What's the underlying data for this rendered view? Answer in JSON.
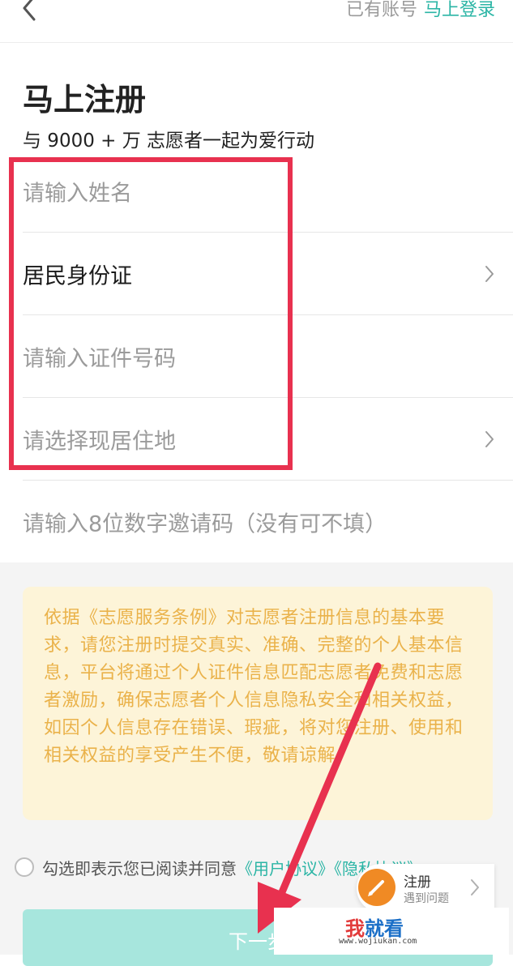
{
  "header": {
    "back_icon": "chevron-left-icon",
    "have_account": "已有账号",
    "login_link": "马上登录"
  },
  "page": {
    "title": "马上注册",
    "subtitle": "与 9000 + 万 志愿者一起为爱行动"
  },
  "form": {
    "name_placeholder": "请输入姓名",
    "id_type_value": "居民身份证",
    "id_number_placeholder": "请输入证件号码",
    "residence_placeholder": "请选择现居住地",
    "invite_placeholder": "请输入8位数字邀请码（没有可不填）"
  },
  "notice": {
    "text": "依据《志愿服务条例》对志愿者注册信息的基本要求，请您注册时提交真实、准确、完整的个人基本信息，平台将通过个人证件信息匹配志愿者免费和志愿者激励，确保志愿者个人信息隐私安全和相关权益，如因个人信息存在错误、瑕疵，将对您注册、使用和相关权益的享受产生不便，敬请谅解。"
  },
  "agreement": {
    "prefix": "勾选即表示您已阅读并同意",
    "user_agreement": "《用户协议》",
    "privacy": "《隐私协议》"
  },
  "help": {
    "title": "注册",
    "subtitle": "遇到问题"
  },
  "actions": {
    "next_label": "下一步"
  },
  "watermark": {
    "logo_red": "我",
    "logo_blue": "就看",
    "url": "www.wojiukan.com"
  },
  "colors": {
    "accent": "#2bb5a5",
    "highlight": "#e8314f",
    "notice_text": "#eab24a",
    "notice_bg": "#fdf4d8",
    "button": "#a7e6dd"
  }
}
